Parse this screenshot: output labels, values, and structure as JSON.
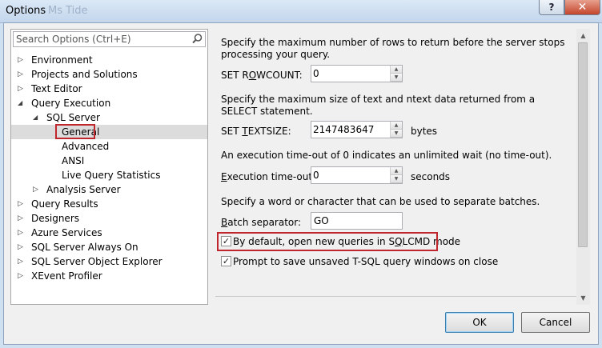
{
  "window": {
    "title": "Options",
    "ghost_text": "Ms Tide",
    "help_label": "?",
    "close_label": "✕"
  },
  "search": {
    "placeholder": "Search Options (Ctrl+E)"
  },
  "tree": [
    {
      "label": "Environment",
      "level": 0,
      "expander": "collapsed"
    },
    {
      "label": "Projects and Solutions",
      "level": 0,
      "expander": "collapsed"
    },
    {
      "label": "Text Editor",
      "level": 0,
      "expander": "collapsed"
    },
    {
      "label": "Query Execution",
      "level": 0,
      "expander": "expanded"
    },
    {
      "label": "SQL Server",
      "level": 1,
      "expander": "expanded"
    },
    {
      "label": "General",
      "level": 2,
      "expander": "none",
      "selected": true
    },
    {
      "label": "Advanced",
      "level": 2,
      "expander": "none"
    },
    {
      "label": "ANSI",
      "level": 2,
      "expander": "none"
    },
    {
      "label": "Live Query Statistics",
      "level": 2,
      "expander": "none"
    },
    {
      "label": "Analysis Server",
      "level": 1,
      "expander": "collapsed"
    },
    {
      "label": "Query Results",
      "level": 0,
      "expander": "collapsed"
    },
    {
      "label": "Designers",
      "level": 0,
      "expander": "collapsed"
    },
    {
      "label": "Azure Services",
      "level": 0,
      "expander": "collapsed"
    },
    {
      "label": "SQL Server Always On",
      "level": 0,
      "expander": "collapsed"
    },
    {
      "label": "SQL Server Object Explorer",
      "level": 0,
      "expander": "collapsed"
    },
    {
      "label": "XEvent Profiler",
      "level": 0,
      "expander": "collapsed"
    }
  ],
  "settings": {
    "rowcount_desc": "Specify the maximum number of rows to return before the server stops processing your query.",
    "rowcount_label_pre": "SET R",
    "rowcount_label_key": "O",
    "rowcount_label_post": "WCOUNT:",
    "rowcount_value": "0",
    "textsize_desc": "Specify the maximum size of text and ntext data returned from a SELECT statement.",
    "textsize_label_pre": "SET ",
    "textsize_label_key": "T",
    "textsize_label_post": "EXTSIZE:",
    "textsize_value": "2147483647",
    "textsize_unit": "bytes",
    "timeout_desc": "An execution time-out of 0 indicates an unlimited wait (no time-out).",
    "timeout_label_key": "E",
    "timeout_label_post": "xecution time-out:",
    "timeout_value": "0",
    "timeout_unit": "seconds",
    "batch_desc": "Specify a word or character that can be used to separate batches.",
    "batch_label_key": "B",
    "batch_label_post": "atch separator:",
    "batch_value": "GO",
    "sqlcmd_label_pre": "By default, open new queries in S",
    "sqlcmd_label_key": "Q",
    "sqlcmd_label_post": "LCMD mode",
    "sqlcmd_checked": true,
    "prompt_label": "Prompt to save unsaved T-SQL query windows on close",
    "prompt_checked": true
  },
  "buttons": {
    "ok": "OK",
    "cancel": "Cancel"
  },
  "colors": {
    "highlight": "#c0262e",
    "selection": "#dcdcdc"
  }
}
